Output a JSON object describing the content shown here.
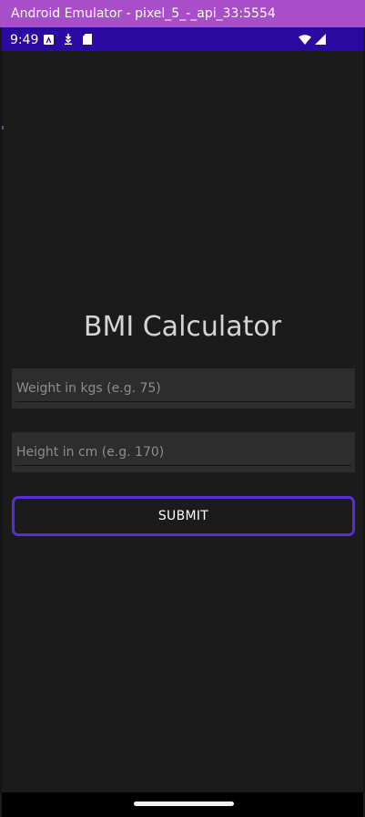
{
  "emulator": {
    "title": "Android Emulator - pixel_5_-_api_33:5554"
  },
  "status_bar": {
    "time": "9:49",
    "left_icons": [
      "android-auto-icon",
      "download-icon",
      "sd-card-icon"
    ],
    "right_icons": [
      "wifi-icon",
      "cellular-signal-icon"
    ]
  },
  "app": {
    "title": "BMI Calculator",
    "weight_field": {
      "placeholder": "Weight in kgs (e.g. 75)",
      "value": ""
    },
    "height_field": {
      "placeholder": "Height in cm (e.g. 170)",
      "value": ""
    },
    "submit_label": "SUBMIT"
  },
  "colors": {
    "emulator_titlebar": "#a94ec9",
    "status_bar": "#2a0aa0",
    "background": "#1b1b1b",
    "field_background": "#2d2d2d",
    "button_border": "#5a2ed6"
  }
}
